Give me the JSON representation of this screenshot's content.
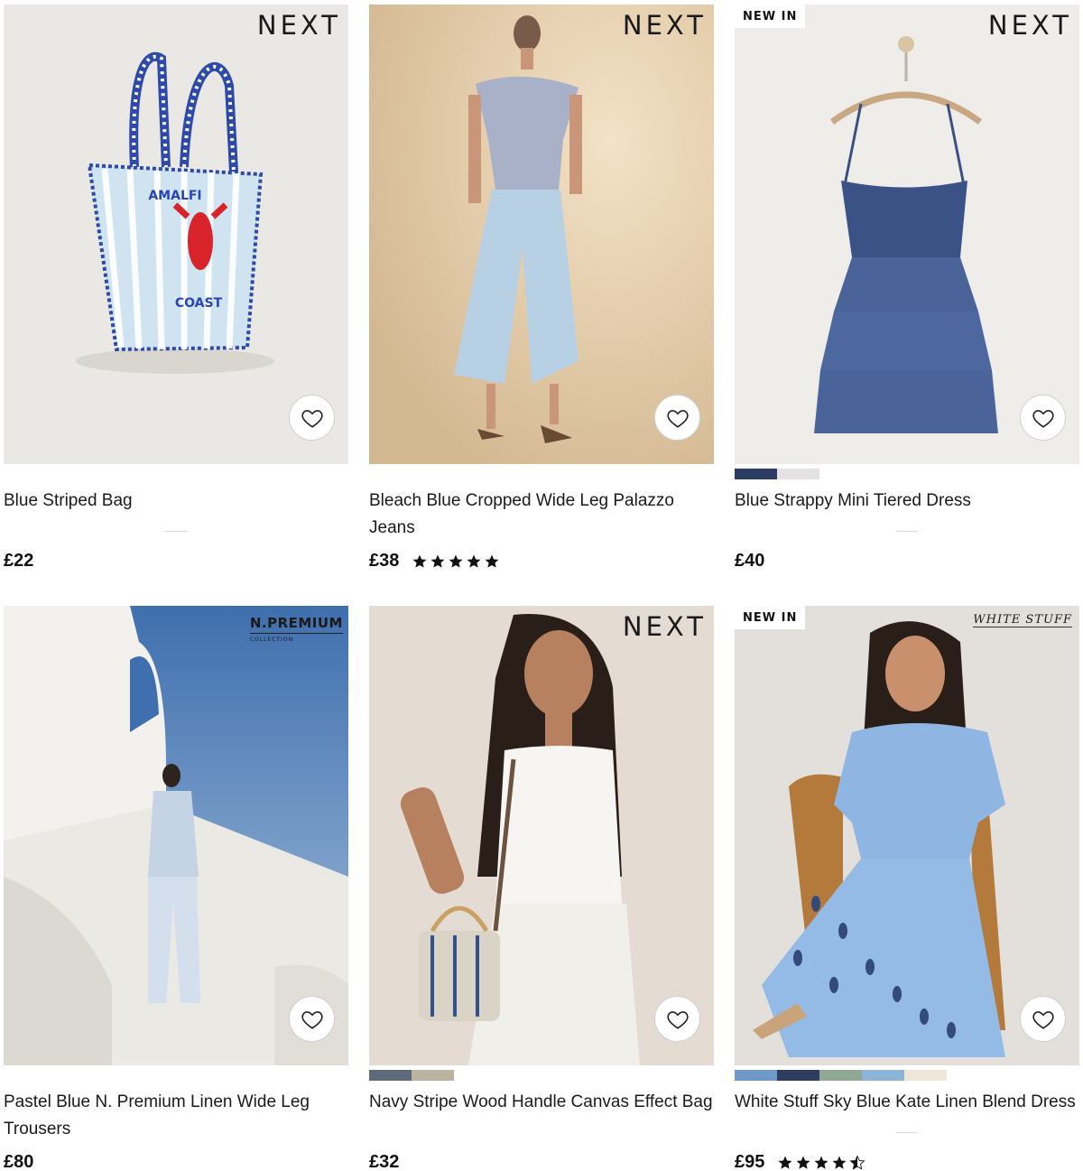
{
  "products": [
    {
      "title": "Blue Striped Bag",
      "price": "£22",
      "brand": "NEXT",
      "badge": "",
      "rating": null,
      "swatches": [],
      "favourite_icon": "heart-outline-icon"
    },
    {
      "title": "Bleach Blue Cropped Wide Leg Palazzo Jeans",
      "price": "£38",
      "brand": "NEXT",
      "badge": "",
      "rating": 5,
      "swatches": [],
      "favourite_icon": "heart-outline-icon"
    },
    {
      "title": "Blue Strappy Mini Tiered Dress",
      "price": "£40",
      "brand": "NEXT",
      "badge": "NEW IN",
      "rating": null,
      "swatches": [
        "#2b3d63",
        "#e6e2e4"
      ],
      "favourite_icon": "heart-outline-icon"
    },
    {
      "title": "Pastel Blue N. Premium Linen Wide Leg Trousers",
      "price": "£80",
      "brand": "N.PREMIUM",
      "brand_sub": "COLLECTION",
      "badge": "",
      "rating": null,
      "swatches": [],
      "favourite_icon": "heart-outline-icon"
    },
    {
      "title": "Navy Stripe Wood Handle Canvas Effect Bag",
      "price": "£32",
      "brand": "NEXT",
      "badge": "",
      "rating": null,
      "swatches": [
        "#5d6a7a",
        "#b9b39f"
      ],
      "favourite_icon": "heart-outline-icon"
    },
    {
      "title": "White Stuff Sky Blue Kate Linen Blend Dress",
      "price": "£95",
      "brand": "WHITE STUFF",
      "badge": "NEW IN",
      "rating": 4.5,
      "swatches": [
        "#6f99c9",
        "#2b3c5c",
        "#8fa893",
        "#8cb4d6",
        "#eee6d6"
      ],
      "favourite_icon": "heart-outline-icon"
    }
  ]
}
